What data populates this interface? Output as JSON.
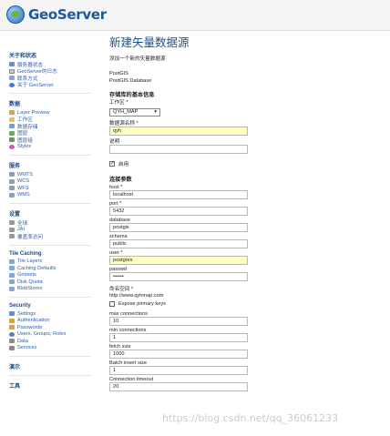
{
  "header": {
    "brand": "GeoServer"
  },
  "sidebar": {
    "sections": [
      {
        "title": "关于和状态",
        "items": [
          "服务器状态",
          "GeoServer的日志",
          "联系方式",
          "关于 GeoServer"
        ]
      },
      {
        "title": "数据",
        "items": [
          "Layer Preview",
          "工作区",
          "数据存储",
          "图层",
          "图层组",
          "Styles"
        ]
      },
      {
        "title": "服务",
        "items": [
          "WMTS",
          "WCS",
          "WFS",
          "WMS"
        ]
      },
      {
        "title": "设置",
        "items": [
          "全球",
          "JAI",
          "覆盖率访问"
        ]
      },
      {
        "title": "Tile Caching",
        "items": [
          "Tile Layers",
          "Caching Defaults",
          "Gridsets",
          "Disk Quota",
          "BlobStores"
        ]
      },
      {
        "title": "Security",
        "items": [
          "Settings",
          "Authentication",
          "Passwords",
          "Users, Groups, Roles",
          "Data",
          "Services"
        ]
      }
    ],
    "demo": "演示",
    "tools": "工具"
  },
  "main": {
    "title": "新建矢量数据源",
    "subtitle": "添加一个新的矢量数据源",
    "type1": "PostGIS",
    "type2": "PostGIS Database",
    "basic_heading": "存储库的基本信息",
    "workspace_label": "工作区 *",
    "workspace_value": "QYH_MAP",
    "datasource_label": "数据源名称 *",
    "datasource_value": "qyh",
    "description_label": "说明",
    "description_value": "",
    "enabled_label": "启用",
    "conn_heading": "连接参数",
    "host_label": "host *",
    "host_value": "localhost",
    "port_label": "port *",
    "port_value": "5432",
    "database_label": "database",
    "database_value": "postgis",
    "schema_label": "schema",
    "schema_value": "public",
    "user_label": "user *",
    "user_value": "postgres",
    "passwd_label": "passwd",
    "passwd_value": "••••••",
    "namespace_label": "命名空间 *",
    "namespace_value": "http://www.qyhmap.com",
    "expose_label": "Expose primary keys",
    "max_conn_label": "max connections",
    "max_conn_value": "10",
    "min_conn_label": "min connections",
    "min_conn_value": "1",
    "fetch_label": "fetch size",
    "fetch_value": "1000",
    "batch_label": "Batch insert size",
    "batch_value": "1",
    "timeout_label": "Connection timeout",
    "timeout_value": "20"
  },
  "watermark": "https://blog.csdn.net/qq_36061233"
}
